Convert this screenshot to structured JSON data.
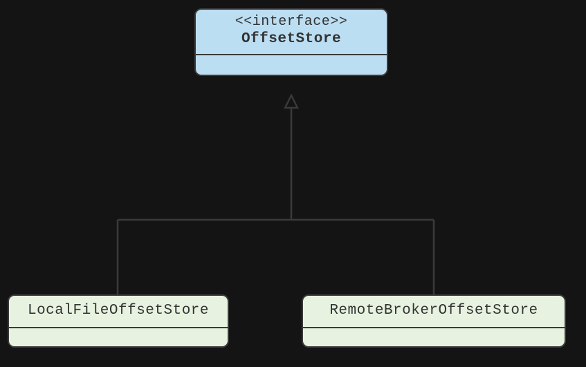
{
  "diagram": {
    "interface": {
      "stereotype": "<<interface>>",
      "name": "OffsetStore"
    },
    "left_class": {
      "name": "LocalFileOffsetStore"
    },
    "right_class": {
      "name": "RemoteBrokerOffsetStore"
    }
  }
}
